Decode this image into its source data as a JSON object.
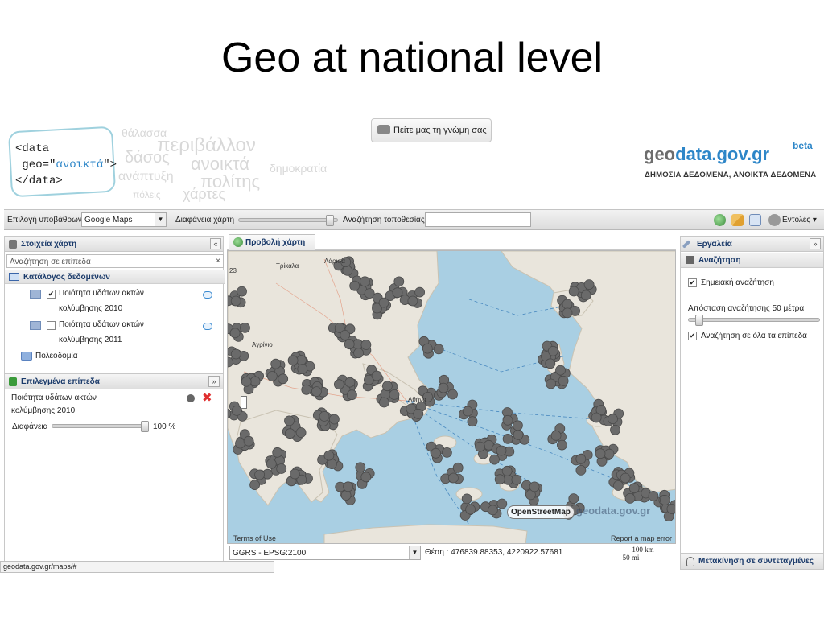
{
  "slide_title": "Geo at national level",
  "header": {
    "logo_lines": [
      "<data",
      "geo=\"",
      "ανοικτά",
      "\">",
      "</data>"
    ],
    "cloud_words": [
      "θάλασσα",
      "περιβάλλον",
      "δάσος",
      "ανοικτά",
      "δημοκρατία",
      "ανάπτυξη",
      "πολίτης",
      "πόλεις",
      "χάρτες"
    ],
    "feedback_label": "Πείτε μας τη γνώμη σας",
    "brand_geo": "geo",
    "brand_rest": "data.gov.gr",
    "beta": "beta",
    "brand_sub": "ΔΗΜΟΣΙΑ ΔΕΔΟΜΕΝΑ, ΑΝΟΙΚΤΑ ΔΕΔΟΜΕΝΑ"
  },
  "toolbar": {
    "base_layer_label": "Επιλογή υποβάθρων",
    "base_layer_value": "Google Maps",
    "opacity_label": "Διαφάνεια χάρτη",
    "opacity_level": 0.95,
    "location_search_label": "Αναζήτηση τοποθεσίας",
    "location_search_value": "",
    "commands_label": "Εντολές"
  },
  "left_panel": {
    "title": "Στοιχεία χάρτη",
    "collapse": "«",
    "search_placeholder": "Αναζήτηση σε επίπεδα",
    "search_clear": "×",
    "catalog_title": "Κατάλογος δεδομένων",
    "layers": [
      {
        "line1": "Ποιότητα υδάτων ακτών",
        "line2": "κολύμβησης 2010",
        "checked": true,
        "check_mark": "✔"
      },
      {
        "line1": "Ποιότητα υδάτων ακτών",
        "line2": "κολύμβησης 2011",
        "checked": false,
        "check_mark": ""
      }
    ],
    "folder": "Πολεοδομία",
    "selected_title": "Επιλεγμένα επίπεδα",
    "selected_collapse": "»",
    "selected_layer_line1": "Ποιότητα υδάτων ακτών",
    "selected_layer_line2": "κολύμβησης 2010",
    "remove_icon": "✖",
    "opacity_label": "Διαφάνεια",
    "opacity_value": "100 %",
    "opacity_level": 1.0
  },
  "map": {
    "tab_label": "Προβολή χάρτη",
    "terms": "Terms of Use",
    "report": "Report a map error",
    "osm_label": "OpenStreetMap",
    "watermark": "geodata.gov.gr",
    "places": [
      "Τρίκαλα",
      "Λάρισα",
      "Αγρίνιο",
      "Αθήνα"
    ],
    "projection": "GGRS - EPSG:2100",
    "coords": "Θέση : 476839.88353, 4220922.57681",
    "scale_km": "100 km",
    "scale_mi": "50 mi",
    "zoom_label": "23"
  },
  "right_panel": {
    "title": "Εργαλεία",
    "collapse": "»",
    "search_title": "Αναζήτηση",
    "point_search": "Σημειακή αναζήτηση",
    "distance_label": "Απόσταση αναζήτησης 50 μέτρα",
    "distance_level": 0.05,
    "all_layers": "Αναζήτηση σε όλα τα επίπεδα",
    "check_mark": "✔",
    "move_coords": "Μετακίνηση σε συντεταγμένες"
  },
  "status_bar": "geodata.gov.gr/maps/#",
  "colors": {
    "accent": "#2d86c8",
    "header_blue": "#1a3a6a",
    "sea": "#a9cfe3",
    "land": "#e9e5dc",
    "marker": "#6a6a6a",
    "remove_red": "#e03030"
  }
}
